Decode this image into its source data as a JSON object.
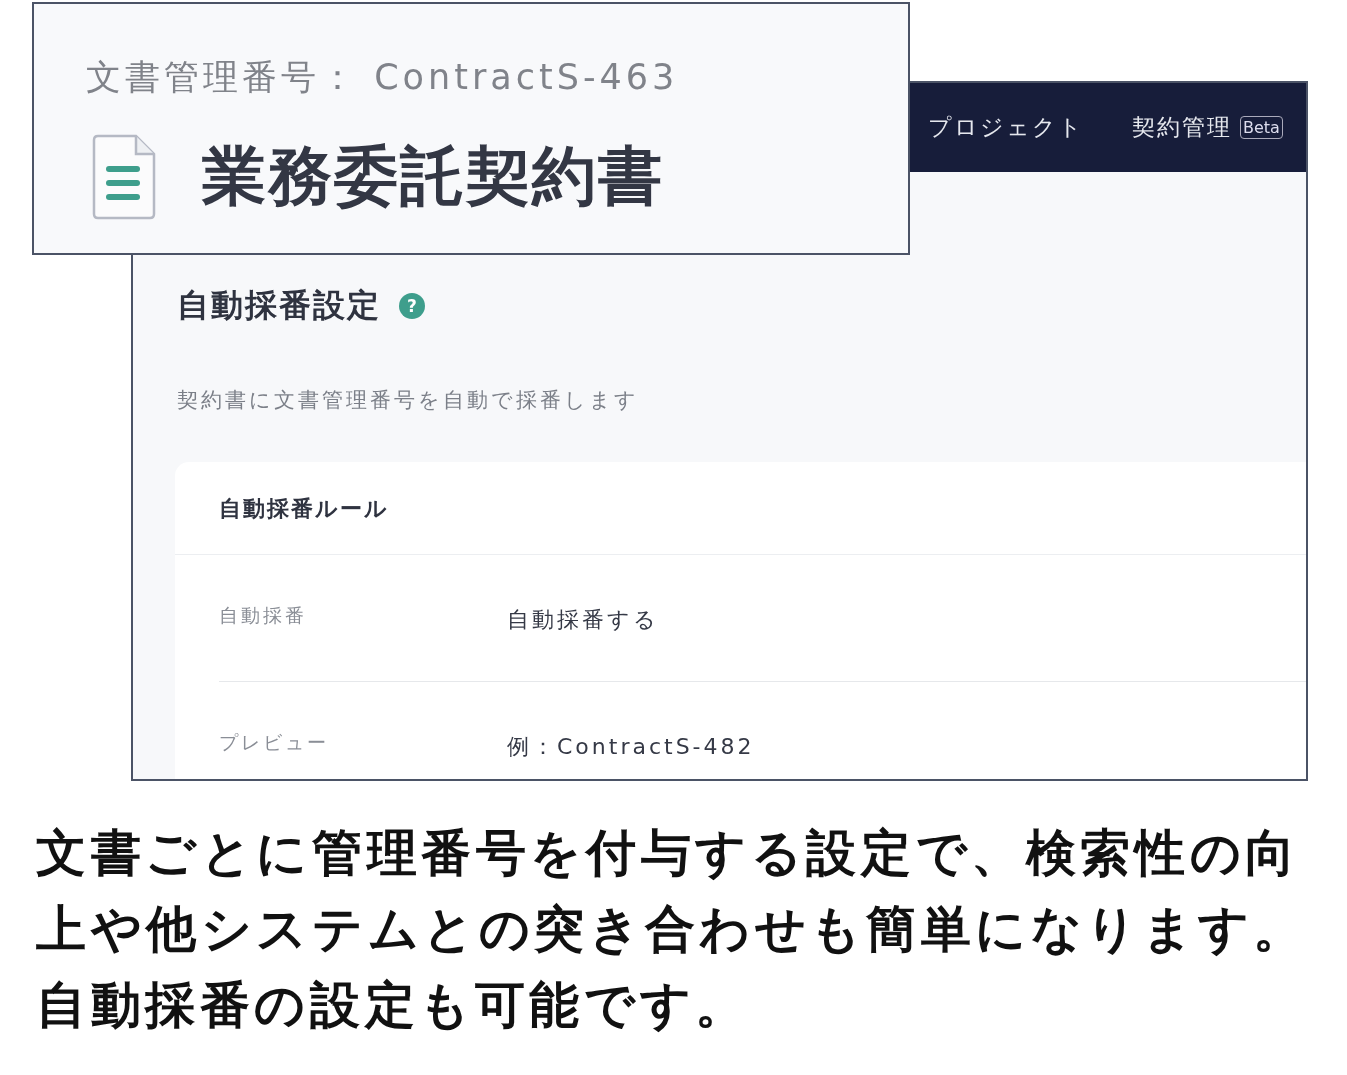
{
  "inset": {
    "number_line": "文書管理番号： ContractS-463",
    "title": "業務委託契約書"
  },
  "nav": {
    "items": [
      {
        "label": "プロジェクト"
      },
      {
        "label": "契約管理",
        "badge": "Beta"
      }
    ]
  },
  "page": {
    "title": "自動採番設定",
    "help": "?",
    "description": "契約書に文書管理番号を自動で採番します",
    "card": {
      "title": "自動採番ルール",
      "rows": [
        {
          "label": "自動採番",
          "value": "自動採番する"
        },
        {
          "label": "プレビュー",
          "value": "例：ContractS-482"
        }
      ]
    }
  },
  "caption": [
    "文書ごとに管理番号を付与する設定で、検索性の向上や他システムとの突き合わせも簡単になります。",
    "自動採番の設定も可能です。"
  ]
}
